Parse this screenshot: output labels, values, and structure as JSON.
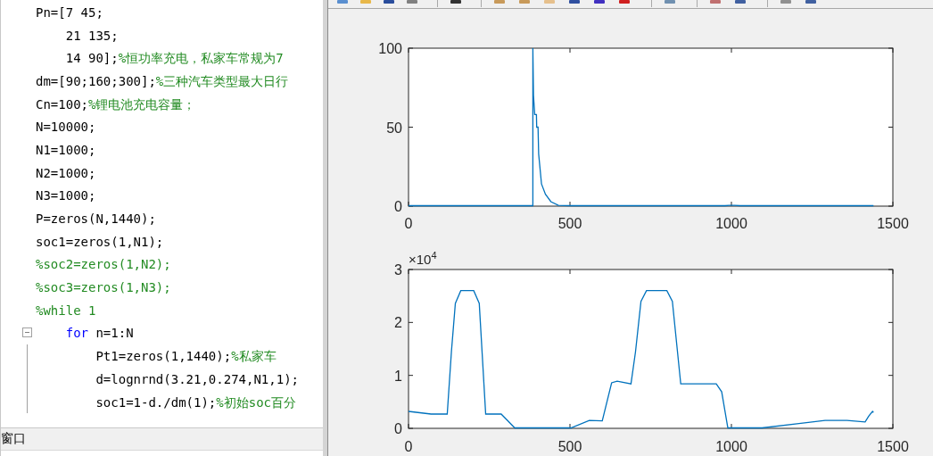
{
  "editor": {
    "lines": [
      {
        "segments": [
          {
            "kind": "code",
            "text": "Pn=[7 45;"
          }
        ]
      },
      {
        "segments": [
          {
            "kind": "code",
            "text": "    21 135;"
          }
        ]
      },
      {
        "segments": [
          {
            "kind": "code",
            "text": "    14 90];"
          },
          {
            "kind": "comment",
            "text": "%恒功率充电，私家车常规为7"
          }
        ]
      },
      {
        "segments": [
          {
            "kind": "code",
            "text": "dm=[90;160;300];"
          },
          {
            "kind": "comment",
            "text": "%三种汽车类型最大日行"
          }
        ]
      },
      {
        "segments": [
          {
            "kind": "code",
            "text": "Cn=100;"
          },
          {
            "kind": "comment",
            "text": "%锂电池充电容量；"
          }
        ]
      },
      {
        "segments": [
          {
            "kind": "code",
            "text": "N=10000;"
          }
        ]
      },
      {
        "segments": [
          {
            "kind": "code",
            "text": "N1=1000;"
          }
        ]
      },
      {
        "segments": [
          {
            "kind": "code",
            "text": "N2=1000;"
          }
        ]
      },
      {
        "segments": [
          {
            "kind": "code",
            "text": "N3=1000;"
          }
        ]
      },
      {
        "segments": [
          {
            "kind": "code",
            "text": "P=zeros(N,1440);"
          }
        ]
      },
      {
        "segments": [
          {
            "kind": "code",
            "text": "soc1=zeros(1,N1);"
          }
        ]
      },
      {
        "segments": [
          {
            "kind": "comment",
            "text": "%soc2=zeros(1,N2);"
          }
        ]
      },
      {
        "segments": [
          {
            "kind": "comment",
            "text": "%soc3=zeros(1,N3);"
          }
        ]
      },
      {
        "segments": [
          {
            "kind": "comment",
            "text": "%while 1"
          }
        ]
      },
      {
        "fold_expanded": true,
        "segments": [
          {
            "kind": "keyword",
            "text": "    for"
          },
          {
            "kind": "code",
            "text": " n=1:N"
          }
        ]
      },
      {
        "segments": [
          {
            "kind": "code",
            "text": "        Pt1=zeros(1,1440);"
          },
          {
            "kind": "comment",
            "text": "%私家车"
          }
        ]
      },
      {
        "segments": [
          {
            "kind": "code",
            "text": "        d=lognrnd(3.21,0.274,N1,1);"
          }
        ]
      },
      {
        "segments": [
          {
            "kind": "code",
            "text": "        soc1=1-d./dm(1);"
          },
          {
            "kind": "comment",
            "text": "%初始soc百分"
          }
        ]
      }
    ]
  },
  "figure": {
    "axes": [
      {
        "chart_data": {
          "type": "line",
          "xlim": [
            0,
            1500
          ],
          "ylim": [
            0,
            100
          ],
          "xticks": [
            0,
            500,
            1000,
            1500
          ],
          "yticks": [
            0,
            50,
            100
          ],
          "x": [
            0,
            385,
            385,
            387,
            391,
            396,
            397,
            401,
            403,
            412,
            424,
            441,
            464,
            503,
            980,
            993,
            1010,
            1027,
            1440
          ],
          "series": [
            {
              "color": "#0072bd",
              "values": [
                0,
                0,
                100,
                70,
                58,
                58,
                50,
                50,
                33,
                14,
                7.5,
                2.8,
                0.5,
                0,
                0,
                0.5,
                0.5,
                0,
                0
              ]
            }
          ]
        }
      },
      {
        "exponent_label": "×10$^{4}$",
        "chart_data": {
          "type": "line",
          "xlim": [
            0,
            1500
          ],
          "ylim": [
            0,
            3
          ],
          "xticks": [
            0,
            500,
            1000,
            1500
          ],
          "yticks": [
            0,
            1,
            2,
            3
          ],
          "x": [
            0,
            70,
            120,
            133,
            145,
            162,
            202,
            219,
            239,
            287,
            329,
            503,
            560,
            600,
            629,
            646,
            689,
            703,
            720,
            737,
            800,
            817,
            843,
            953,
            970,
            989,
            1095,
            1209,
            1290,
            1358,
            1414,
            1425,
            1437,
            1440
          ],
          "series": [
            {
              "color": "#0072bd",
              "values": [
                0.32,
                0.27,
                0.27,
                1.45,
                2.36,
                2.6,
                2.6,
                2.36,
                0.27,
                0.27,
                0,
                0,
                0.15,
                0.14,
                0.86,
                0.89,
                0.84,
                1.45,
                2.4,
                2.6,
                2.6,
                2.4,
                0.84,
                0.84,
                0.69,
                0,
                0,
                0.09,
                0.15,
                0.15,
                0.12,
                0.23,
                0.32,
                0.3
              ]
            }
          ]
        }
      }
    ]
  },
  "command_window": {
    "title": "窗口"
  }
}
